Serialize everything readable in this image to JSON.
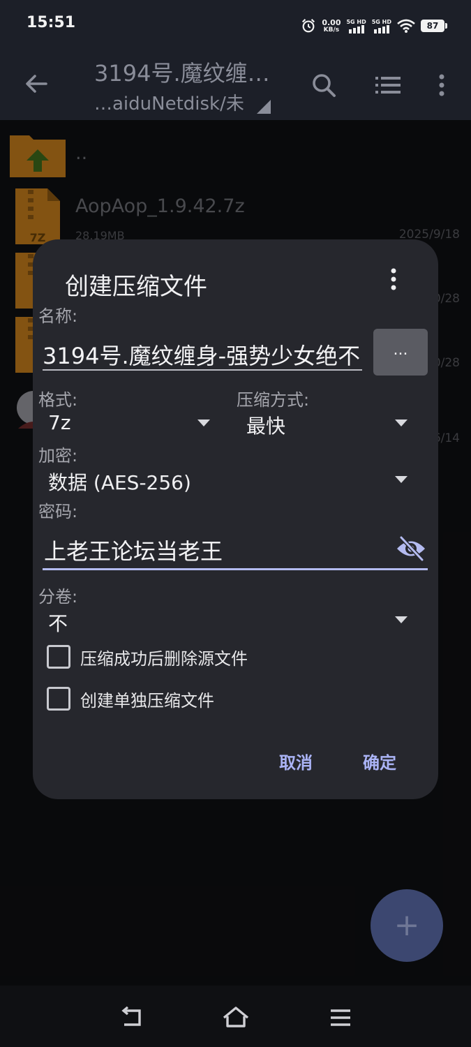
{
  "status_bar": {
    "time": "15:51",
    "net_speed_value": "0.00",
    "net_speed_unit": "KB/s",
    "sim1_label": "5G HD",
    "sim2_label": "5G HD",
    "battery": "87"
  },
  "app_bar": {
    "title": "3194号.魔纹缠…",
    "subtitle": "…aiduNetdisk/未"
  },
  "files": [
    {
      "name": "..",
      "size": "",
      "date": "",
      "icon": "folder-up-icon"
    },
    {
      "name": "AopAop_1.9.42.7z",
      "size": "28.19MB",
      "date": "2025/9/18",
      "icon": "archive-7z-icon"
    },
    {
      "name": "",
      "size": "",
      "date": "0/28",
      "icon": "archive-7z-icon"
    },
    {
      "name": "",
      "size": "",
      "date": "0/28",
      "icon": "archive-7z-icon"
    },
    {
      "name": "",
      "size": "",
      "date": "6/14",
      "icon": "image-thumbnail"
    }
  ],
  "dialog": {
    "title": "创建压缩文件",
    "name_label": "名称:",
    "name_value": "3194号.魔纹缠身-强势少女绝不",
    "browse_label": "...",
    "format_label": "格式:",
    "format_value": "7z",
    "method_label": "压缩方式:",
    "method_value": "最快",
    "encryption_label": "加密:",
    "encryption_value": "数据 (AES-256)",
    "password_label": "密码:",
    "password_value": "上老王论坛当老王",
    "split_label": "分卷:",
    "split_value": "不",
    "delete_source_label": "压缩成功后删除源文件",
    "separate_archives_label": "创建单独压缩文件",
    "cancel_label": "取消",
    "ok_label": "确定"
  },
  "fab": {
    "label": "+"
  },
  "colors": {
    "accent": "#aab3f5",
    "dialog_bg": "#26272d",
    "app_bar_bg": "#1c1f28",
    "fab_bg": "#3c4770"
  }
}
